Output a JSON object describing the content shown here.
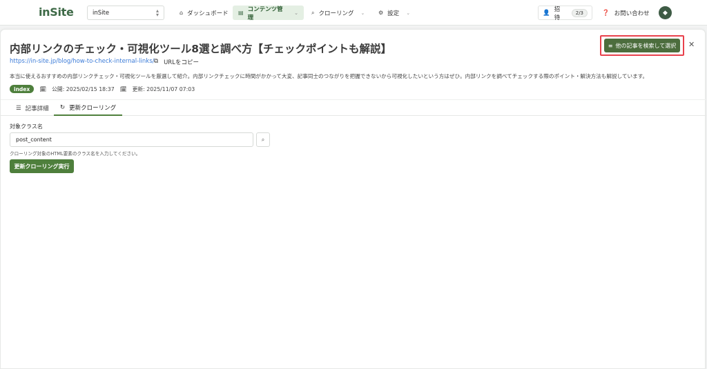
{
  "topbar": {
    "logo": "inSite",
    "site_select": "inSite",
    "nav": [
      {
        "label": "ダッシュボード",
        "icon": "home-icon"
      },
      {
        "label": "コンテンツ管理",
        "icon": "document-icon"
      },
      {
        "label": "クローリング",
        "icon": "search-icon"
      },
      {
        "label": "設定",
        "icon": "gear-icon"
      }
    ],
    "invite_label": "招待",
    "invite_count": "2/3",
    "contact_label": "お問い合わせ"
  },
  "article": {
    "title": "内部リンクのチェック・可視化ツール8選と調べ方【チェックポイントも解説】",
    "pick_button": "他の記事を検索して選択",
    "url": "https://in-site.jp/blog/how-to-check-internal-links/",
    "copy_label": "URLをコピー",
    "description": "本当に使えるおすすめの内部リンクチェック・可視化ツールを厳選して紹介。内部リンクチェックに時間がかかって大変、記事同士のつながりを把握できないから可視化したいという方はぜひ。内部リンクを調べてチェックする際のポイント・解決方法も解説しています。",
    "status_badge": "index",
    "published": "公開: 2025/02/15 18:37",
    "updated": "更新: 2025/11/07 07:03"
  },
  "tabs": [
    {
      "label": "記事詳細",
      "icon": "list-icon"
    },
    {
      "label": "更新クローリング",
      "icon": "refresh-icon"
    }
  ],
  "form": {
    "label": "対象クラス名",
    "value": "post_content",
    "help": "クローリング対象のHTML要素のクラス名を入力してください。",
    "submit": "更新クローリング実行"
  },
  "colors": {
    "brand": "#3e6a47",
    "primary_button": "#4e7f3c",
    "highlight_border": "#e8404b",
    "link": "#3b7bd8"
  }
}
